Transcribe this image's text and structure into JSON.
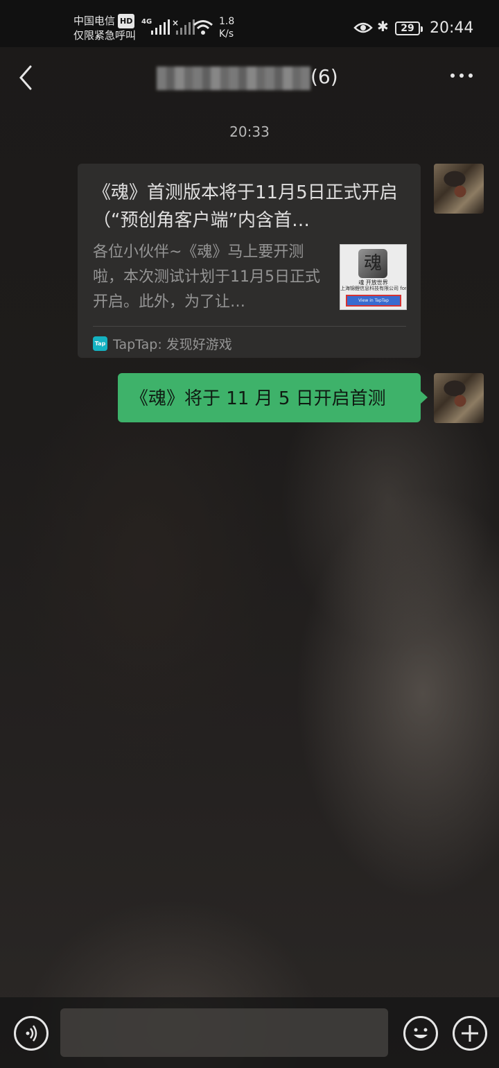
{
  "status_bar": {
    "carrier": "中国电信",
    "hd_badge": "HD",
    "emergency": "仅限紧急呼叫",
    "network_type": "4G",
    "speed_value": "1.8",
    "speed_unit": "K/s",
    "battery": "29",
    "time": "20:44"
  },
  "header": {
    "title_suffix": "(6)"
  },
  "chat": {
    "timestamp": "20:33",
    "link_card": {
      "title": "《魂》首测版本将于11月5日正式开启（“预创角客户端”内含首…",
      "description": "各位小伙伴~《魂》马上要开测啦，本次测试计划于11月5日正式开启。此外，为了让…",
      "thumbnail_logo": "魂",
      "thumbnail_caption1": "魂 开放世界",
      "thumbnail_caption2": "上海锦鲤信息科技有限公司 for iOS",
      "thumbnail_button": "View in TapTap",
      "source_icon_text": "Tap",
      "source_label": "TapTap: 发现好游戏"
    },
    "text_message": "《魂》将于 11 月 5 日开启首测"
  },
  "icons": {
    "back": "back-arrow-icon",
    "more": "more-dots-icon",
    "voice": "voice-icon",
    "emoji": "emoji-icon",
    "add": "plus-icon"
  },
  "colors": {
    "bubble_green": "#3eb26a",
    "taptap_cyan": "#14b9c8"
  }
}
